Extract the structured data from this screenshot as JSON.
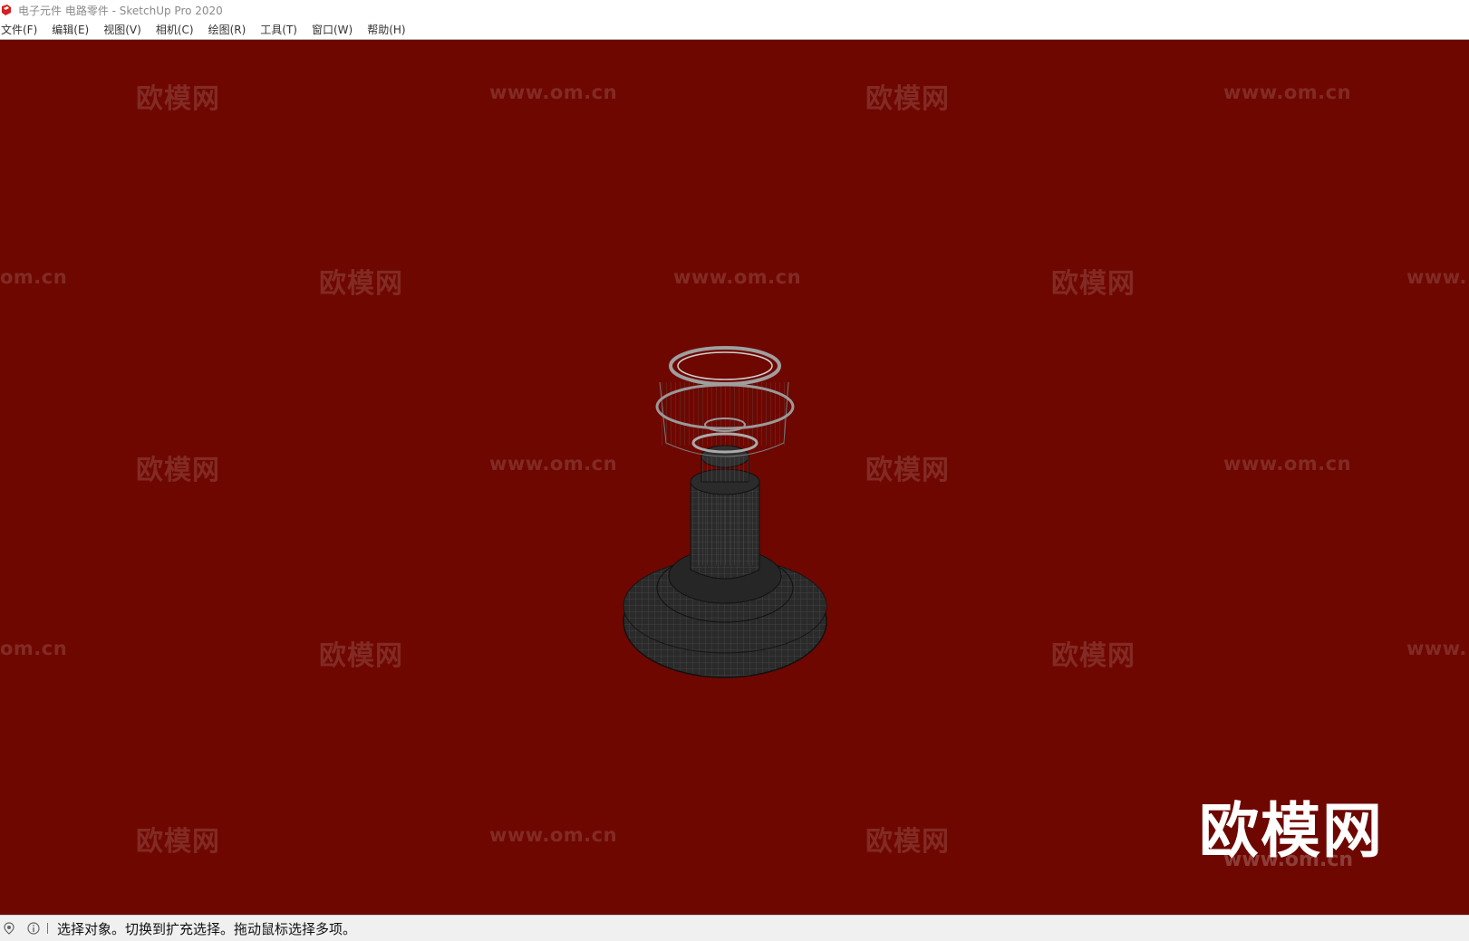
{
  "window": {
    "title": "电子元件 电路零件 - SketchUp Pro 2020",
    "app_icon": "sketchup-logo-icon",
    "app_icon_color": "#d61f1f"
  },
  "menu": [
    {
      "label": "文件(F)"
    },
    {
      "label": "编辑(E)"
    },
    {
      "label": "视图(V)"
    },
    {
      "label": "相机(C)"
    },
    {
      "label": "绘图(R)"
    },
    {
      "label": "工具(T)"
    },
    {
      "label": "窗口(W)"
    },
    {
      "label": "帮助(H)"
    }
  ],
  "viewport": {
    "background": "#6e0700",
    "model": "wireframe-lamp-model",
    "watermark_cn": "欧模网",
    "watermark_url": "www.om.cn",
    "watermark_partial_left": "om.cn",
    "watermark_partial_right": "www.",
    "brand_logo": "欧模网",
    "brand_url": "www.om.cn"
  },
  "statusbar": {
    "icons": [
      "geo-location-icon",
      "info-icon"
    ],
    "message": "选择对象。切换到扩充选择。拖动鼠标选择多项。"
  }
}
